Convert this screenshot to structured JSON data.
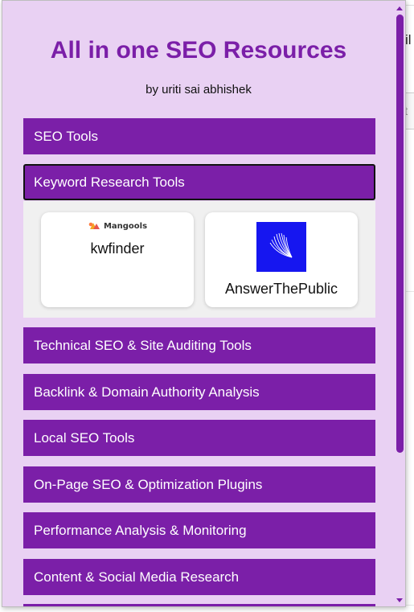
{
  "background": {
    "fragment": "il",
    "input_fragment": "t"
  },
  "popup": {
    "title": "All in one SEO Resources",
    "subtitle": "by uriti sai abhishek",
    "sections": [
      {
        "label": "SEO Tools"
      },
      {
        "label": "Keyword Research Tools"
      },
      {
        "label": "Technical SEO & Site Auditing Tools"
      },
      {
        "label": "Backlink & Domain Authority Analysis"
      },
      {
        "label": "Local SEO Tools"
      },
      {
        "label": "On-Page SEO & Optimization Plugins"
      },
      {
        "label": "Performance Analysis & Monitoring"
      },
      {
        "label": "Content & Social Media Research"
      }
    ],
    "expanded_section": "Keyword Research Tools",
    "tools": [
      {
        "logo_text": "Mangools",
        "label": "kwfinder",
        "icon": "mangools-logo-icon"
      },
      {
        "label": "AnswerThePublic",
        "icon": "answerthepublic-logo-icon"
      }
    ]
  },
  "colors": {
    "popup_bg": "#e9d1f3",
    "accent": "#7b1fa8",
    "panel_bg": "#f0f0f0",
    "atp_blue": "#1616f0"
  }
}
